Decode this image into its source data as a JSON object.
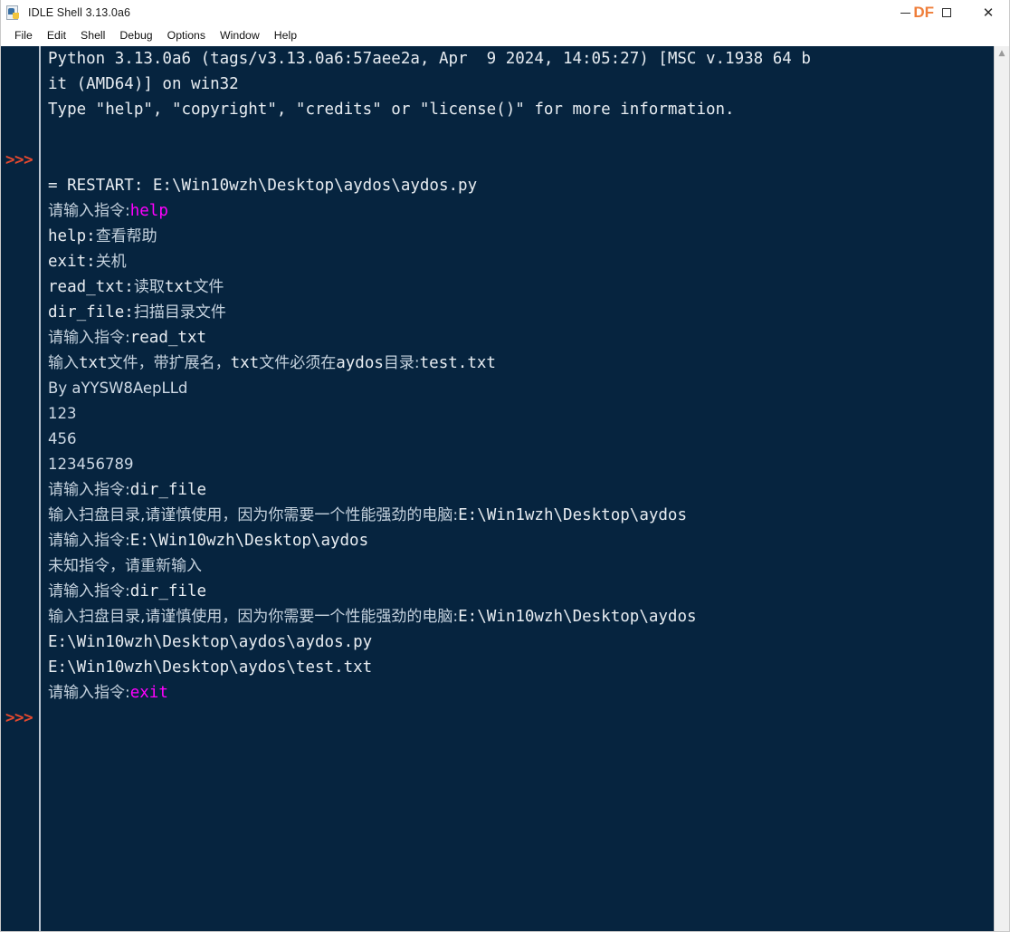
{
  "window": {
    "title": "IDLE Shell 3.13.0a6",
    "icon": "python-file-icon",
    "overlay_text": "DF",
    "overlay_color": "#ef7e3a",
    "minimize_label": "Minimize",
    "maximize_label": "Maximize",
    "close_label": "Close"
  },
  "menubar": {
    "items": [
      {
        "label": "File"
      },
      {
        "label": "Edit"
      },
      {
        "label": "Shell"
      },
      {
        "label": "Debug"
      },
      {
        "label": "Options"
      },
      {
        "label": "Window"
      },
      {
        "label": "Help"
      }
    ]
  },
  "theme": {
    "console_bg": "#06243f",
    "text_color": "#e8edf2",
    "cjk_text_color": "#c5d2de",
    "prompt_color": "#e4492f",
    "user_input_color": "#ff00ff",
    "scrollbar_bg": "#f0f0f0"
  },
  "console": {
    "prompt_symbol": ">>>",
    "prompt_rows": [
      4,
      25
    ],
    "scrollbar": {
      "arrow_up": "▲"
    },
    "lines": [
      {
        "row": 0,
        "prompt": false,
        "segments": [
          {
            "text": "Python 3.13.0a6 (tags/v3.13.0a6:57aee2a, Apr  9 2024, 14:05:27) [MSC v.1938 64 b",
            "style": "mono"
          }
        ]
      },
      {
        "row": 1,
        "prompt": false,
        "segments": [
          {
            "text": "it (AMD64)] on win32",
            "style": "mono"
          }
        ]
      },
      {
        "row": 2,
        "prompt": false,
        "segments": [
          {
            "text": "Type \"help\", \"copyright\", \"credits\" or \"license()\" for more information.",
            "style": "mono"
          }
        ]
      },
      {
        "row": 3,
        "prompt": false,
        "segments": [
          {
            "text": "",
            "style": "mono"
          }
        ]
      },
      {
        "row": 4,
        "prompt": true,
        "segments": [
          {
            "text": "",
            "style": "mono"
          }
        ]
      },
      {
        "row": 5,
        "prompt": false,
        "segments": [
          {
            "text": "= RESTART: E:\\Win10wzh\\Desktop\\aydos\\aydos.py",
            "style": "mono"
          }
        ]
      },
      {
        "row": 6,
        "prompt": false,
        "segments": [
          {
            "text": "请输入指令:",
            "style": "cn"
          },
          {
            "text": "help",
            "style": "magenta"
          }
        ]
      },
      {
        "row": 7,
        "prompt": false,
        "segments": [
          {
            "text": "help:",
            "style": "mono"
          },
          {
            "text": "查看帮助",
            "style": "cn"
          }
        ]
      },
      {
        "row": 8,
        "prompt": false,
        "segments": [
          {
            "text": "exit:",
            "style": "mono"
          },
          {
            "text": "关机",
            "style": "cn"
          }
        ]
      },
      {
        "row": 9,
        "prompt": false,
        "segments": [
          {
            "text": "read_txt:",
            "style": "mono"
          },
          {
            "text": "读取",
            "style": "cn"
          },
          {
            "text": "txt",
            "style": "mono"
          },
          {
            "text": "文件",
            "style": "cn"
          }
        ]
      },
      {
        "row": 10,
        "prompt": false,
        "segments": [
          {
            "text": "dir_file:",
            "style": "mono"
          },
          {
            "text": "扫描目录文件",
            "style": "cn"
          }
        ]
      },
      {
        "row": 11,
        "prompt": false,
        "segments": [
          {
            "text": "请输入指令:",
            "style": "cn"
          },
          {
            "text": "read_txt",
            "style": "mono"
          }
        ]
      },
      {
        "row": 12,
        "prompt": false,
        "segments": [
          {
            "text": "输入",
            "style": "cn"
          },
          {
            "text": "txt",
            "style": "mono"
          },
          {
            "text": "文件，带扩展名，",
            "style": "cn"
          },
          {
            "text": "txt",
            "style": "mono"
          },
          {
            "text": "文件必须在",
            "style": "cn"
          },
          {
            "text": "aydos",
            "style": "mono"
          },
          {
            "text": "目录:",
            "style": "cn"
          },
          {
            "text": "test.txt",
            "style": "mono"
          }
        ]
      },
      {
        "row": 13,
        "prompt": false,
        "segments": [
          {
            "text": "By aYYSW8AepLLd",
            "style": "sans"
          }
        ]
      },
      {
        "row": 14,
        "prompt": false,
        "segments": [
          {
            "text": "123",
            "style": "sans"
          }
        ]
      },
      {
        "row": 15,
        "prompt": false,
        "segments": [
          {
            "text": "456",
            "style": "sans"
          }
        ]
      },
      {
        "row": 16,
        "prompt": false,
        "segments": [
          {
            "text": "123456789",
            "style": "sans"
          }
        ]
      },
      {
        "row": 17,
        "prompt": false,
        "segments": [
          {
            "text": "请输入指令:",
            "style": "cn"
          },
          {
            "text": "dir_file",
            "style": "mono"
          }
        ]
      },
      {
        "row": 18,
        "prompt": false,
        "segments": [
          {
            "text": "输入扫盘目录,请谨慎使用，因为你需要一个性能强劲的电脑:",
            "style": "cn"
          },
          {
            "text": "E:\\Win1wzh\\Desktop\\aydos",
            "style": "mono"
          }
        ]
      },
      {
        "row": 19,
        "prompt": false,
        "segments": [
          {
            "text": "请输入指令:",
            "style": "cn"
          },
          {
            "text": "E:\\Win10wzh\\Desktop\\aydos",
            "style": "mono"
          }
        ]
      },
      {
        "row": 20,
        "prompt": false,
        "segments": [
          {
            "text": "未知指令，请重新输入",
            "style": "cn"
          }
        ]
      },
      {
        "row": 21,
        "prompt": false,
        "segments": [
          {
            "text": "请输入指令:",
            "style": "cn"
          },
          {
            "text": "dir_file",
            "style": "mono"
          }
        ]
      },
      {
        "row": 22,
        "prompt": false,
        "segments": [
          {
            "text": "输入扫盘目录,请谨慎使用，因为你需要一个性能强劲的电脑:",
            "style": "cn"
          },
          {
            "text": "E:\\Win10wzh\\Desktop\\aydos",
            "style": "mono"
          }
        ]
      },
      {
        "row": 23,
        "prompt": false,
        "segments": [
          {
            "text": "E:\\Win10wzh\\Desktop\\aydos\\aydos.py",
            "style": "mono"
          }
        ]
      },
      {
        "row": 24,
        "prompt": false,
        "segments": [
          {
            "text": "E:\\Win10wzh\\Desktop\\aydos\\test.txt",
            "style": "mono"
          }
        ]
      },
      {
        "row": 25,
        "prompt": false,
        "segments": [
          {
            "text": "请输入指令:",
            "style": "cn"
          },
          {
            "text": "exit",
            "style": "magenta"
          }
        ]
      },
      {
        "row": 26,
        "prompt": true,
        "segments": [
          {
            "text": "",
            "style": "mono"
          }
        ]
      }
    ]
  }
}
